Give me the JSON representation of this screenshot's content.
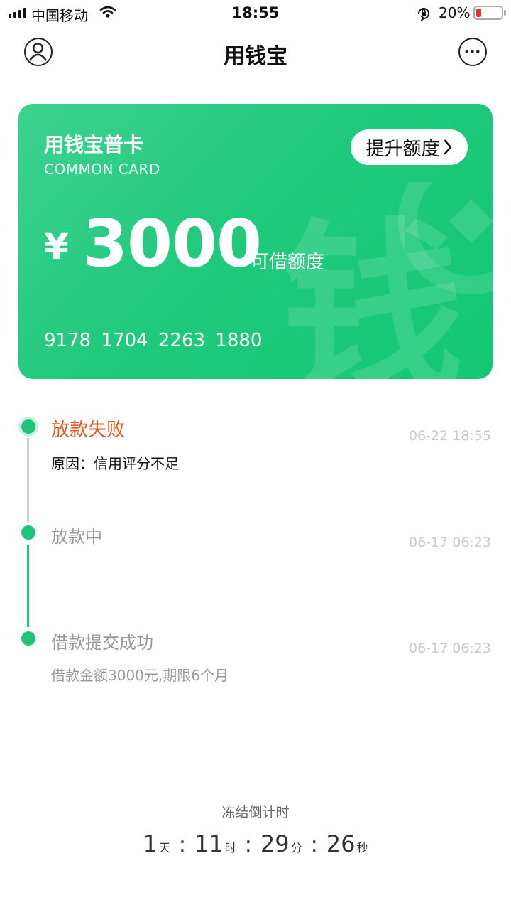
{
  "status_bar": {
    "carrier": "中国移动",
    "time": "18:55",
    "battery_percent": "20%",
    "battery_level": 0.2,
    "icons": [
      "signal-icon",
      "wifi-icon",
      "orientation-lock-icon",
      "battery-icon"
    ]
  },
  "header": {
    "title": "用钱宝",
    "left_icon": "user-icon",
    "right_icon": "more-icon"
  },
  "card": {
    "name": "用钱宝普卡",
    "subtitle": "COMMON CARD",
    "upgrade_label": "提升额度",
    "currency": "¥",
    "amount": "3000",
    "amount_label": "可借额度",
    "card_number": "9178  1704  2263  1880",
    "background_glyph": "钱",
    "colors": {
      "start": "#3dd28f",
      "end": "#14c873"
    }
  },
  "timeline": [
    {
      "title": "放款失败",
      "desc": "原因：信用评分不足",
      "time": "06-22 18:55",
      "title_color": "#e8541e",
      "desc_color": "#111111",
      "state": "current"
    },
    {
      "title": "放款中",
      "desc": "",
      "time": "06-17 06:23",
      "title_color": "#999999",
      "desc_color": "#999999",
      "state": "done"
    },
    {
      "title": "借款提交成功",
      "desc": "借款金额3000元,期限6个月",
      "time": "06-17 06:23",
      "title_color": "#999999",
      "desc_color": "#999999",
      "state": "done"
    }
  ],
  "countdown": {
    "label": "冻结倒计时",
    "days": "1",
    "days_unit": "天",
    "hours": "11",
    "hours_unit": "时",
    "minutes": "29",
    "minutes_unit": "分",
    "seconds": "26",
    "seconds_unit": "秒",
    "separator": ":"
  },
  "colors": {
    "accent": "#1fc37a",
    "error": "#e8541e"
  }
}
